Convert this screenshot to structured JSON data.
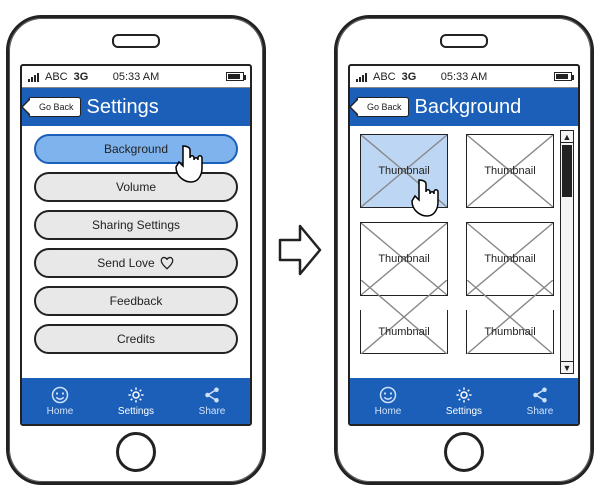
{
  "status": {
    "carrier": "ABC",
    "network": "3G",
    "time": "05:33 AM"
  },
  "left": {
    "goBack": "Go Back",
    "title": "Settings",
    "menu": {
      "background": "Background",
      "volume": "Volume",
      "sharing": "Sharing Settings",
      "sendLove": "Send Love",
      "feedback": "Feedback",
      "credits": "Credits"
    }
  },
  "right": {
    "goBack": "Go Back",
    "title": "Background",
    "thumbLabel": "Thumbnail"
  },
  "tabs": {
    "home": "Home",
    "settings": "Settings",
    "share": "Share"
  }
}
